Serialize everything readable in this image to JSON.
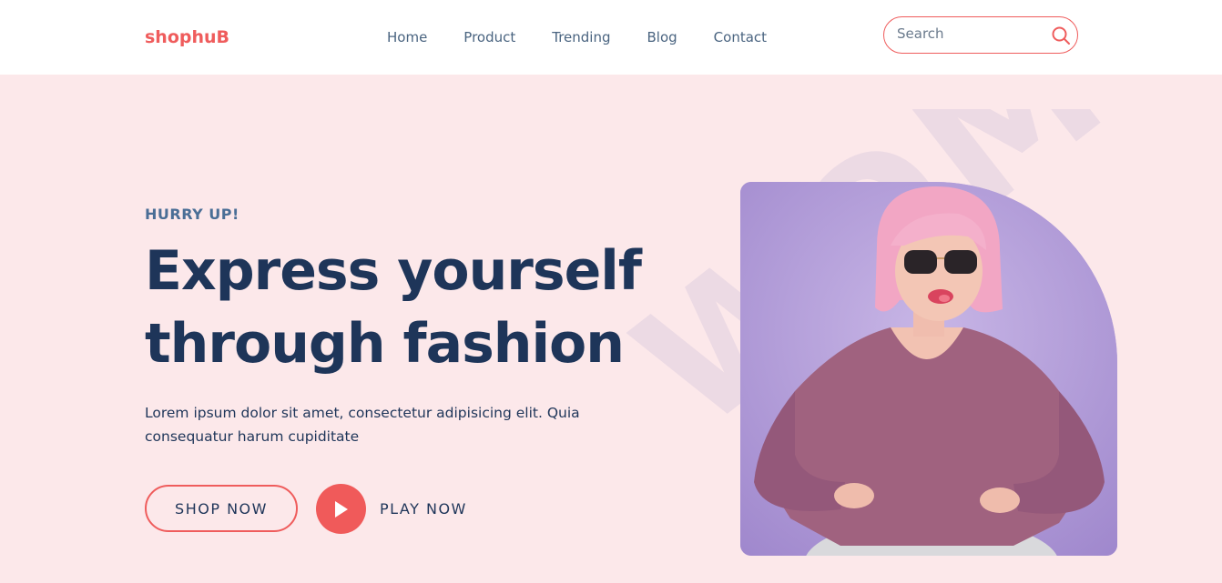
{
  "brand": {
    "logo": "shophuB"
  },
  "nav": {
    "links": [
      {
        "label": "Home"
      },
      {
        "label": "Product"
      },
      {
        "label": "Trending"
      },
      {
        "label": "Blog"
      },
      {
        "label": "Contact"
      }
    ]
  },
  "search": {
    "placeholder": "Search",
    "icon": "search-icon"
  },
  "hero": {
    "eyebrow": "HURRY UP!",
    "title_line1": "Express yourself",
    "title_line2": "through fashion",
    "description": "Lorem ipsum dolor sit amet, consectetur adipisicing elit. Quia consequatur harum cupiditate",
    "shop_button": "SHOP NOW",
    "play_label": "PLAY NOW",
    "watermark": "WOMEN",
    "image": "woman-pink-hair-sweater"
  },
  "colors": {
    "accent": "#ef5c5c",
    "navy": "#1e3559",
    "nav_text": "#4a6480",
    "hero_bg": "#fce8ea",
    "watermark": "#ecdae4",
    "image_bg": "#b4a0d8"
  }
}
